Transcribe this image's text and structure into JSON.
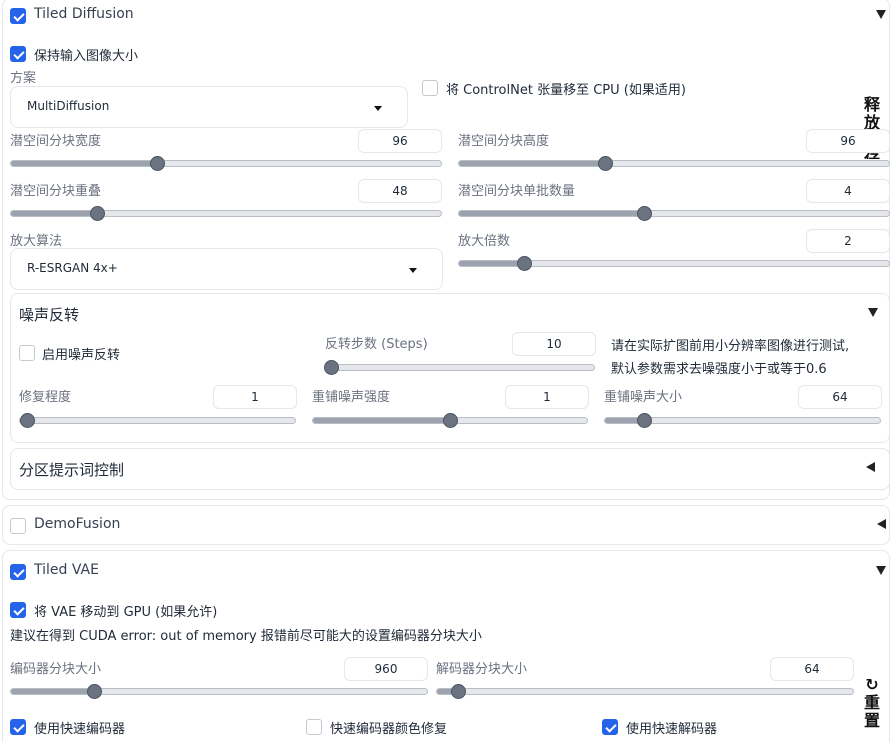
{
  "tiled_diffusion": {
    "title": "Tiled Diffusion",
    "keep_size_label": "保持输入图像大小",
    "method_label": "方案",
    "method_value": "MultiDiffusion",
    "move_controlnet_label": "将 ControlNet 张量移至 CPU (如果适用)",
    "latent_tile_width_label": "潜空间分块宽度",
    "latent_tile_width_value": "96",
    "latent_tile_height_label": "潜空间分块高度",
    "latent_tile_height_value": "96",
    "latent_tile_overlap_label": "潜空间分块重叠",
    "latent_tile_overlap_value": "48",
    "latent_tile_batch_label": "潜空间分块单批数量",
    "latent_tile_batch_value": "4",
    "upscaler_label": "放大算法",
    "upscaler_value": "R-ESRGAN 4x+",
    "scale_factor_label": "放大倍数",
    "scale_factor_value": "2",
    "side_release": [
      "释",
      "放"
    ],
    "side_partial": "存"
  },
  "noise_inversion": {
    "title": "噪声反转",
    "enable_label": "启用噪声反转",
    "steps_label": "反转步数 (Steps)",
    "steps_value": "10",
    "hint_line1": "请在实际扩图前用小分辨率图像进行测试,",
    "hint_line2": "默认参数需求去噪强度小于或等于0.6",
    "retouch_label": "修复程度",
    "retouch_value": "1",
    "renoise_strength_label": "重铺噪声强度",
    "renoise_strength_value": "1",
    "renoise_size_label": "重铺噪声大小",
    "renoise_size_value": "64"
  },
  "region_prompt": {
    "title": "分区提示词控制"
  },
  "demofusion": {
    "title": "DemoFusion"
  },
  "tiled_vae": {
    "title": "Tiled VAE",
    "move_vae_label": "将 VAE 移动到 GPU (如果允许)",
    "advice_text": "建议在得到 CUDA error: out of memory 报错前尽可能大的设置编码器分块大小",
    "encoder_tile_label": "编码器分块大小",
    "encoder_tile_value": "960",
    "decoder_tile_label": "解码器分块大小",
    "decoder_tile_value": "64",
    "fast_encoder_label": "使用快速编码器",
    "encoder_color_fix_label": "快速编码器颜色修复",
    "fast_decoder_label": "使用快速解码器",
    "reset_icon_glyph": "↻",
    "reset_chars": [
      "重",
      "置"
    ]
  },
  "sliders": {
    "tile_width": 0.34,
    "tile_height": 0.34,
    "tile_overlap": 0.2,
    "tile_batch": 0.43,
    "scale_factor": 0.15,
    "steps": 0.02,
    "retouch": 0.0,
    "renoise_strength": 0.5,
    "renoise_size": 0.14,
    "encoder_tile": 0.2,
    "decoder_tile": 0.05
  },
  "checkboxes": {
    "tiled_diffusion": true,
    "keep_size": true,
    "move_controlnet": false,
    "noise_inversion": false,
    "demofusion": false,
    "tiled_vae": true,
    "move_vae": true,
    "fast_encoder": true,
    "encoder_color_fix": false,
    "fast_decoder": true
  },
  "colors": {
    "accent": "#2563eb",
    "slider_thumb": "#6b7280",
    "border": "#e5e7eb"
  }
}
